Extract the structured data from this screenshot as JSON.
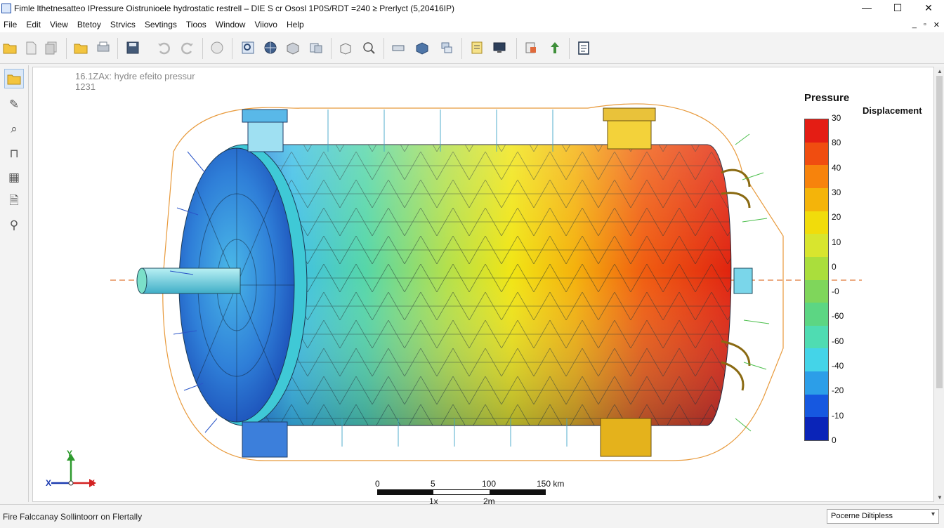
{
  "window": {
    "title": "Fimle lthetnesatteo IPressure Oistrunioele hydrostatic restrell – DIE S cr Ososl  1P0S/RDT =240 ≥ Prerlyct (5,20416IP)",
    "controls": [
      "—",
      "☐",
      "✕"
    ]
  },
  "menu": {
    "items": [
      "File",
      "Edit",
      "View",
      "Btetoy",
      "Strvics",
      "Sevtings",
      "Tioos",
      "Window",
      "Viiovo",
      "Help"
    ],
    "mdi_controls": [
      "_",
      "▫",
      "✕"
    ]
  },
  "toolbar": {
    "buttons": [
      "open-folder",
      "new-file",
      "copy-pages",
      "folder",
      "print-preview",
      "save-disk",
      "undo",
      "redo",
      "fit-view",
      "zoom-region",
      "globe",
      "cube-shaded",
      "window-layers",
      "box-3d",
      "zoom-settings",
      "measure",
      "package",
      "stack-layers",
      "checklist",
      "monitor",
      "export-doc",
      "upload-arrow",
      "report"
    ]
  },
  "left_tools": [
    "open-file",
    "pencil-edit",
    "zoom-search",
    "clamp-tool",
    "mesh-grid",
    "document-search",
    "node-select"
  ],
  "viewport": {
    "label_line1": "16.1ZAx:  hydre efeito pressur",
    "label_line2": "1231",
    "axes": {
      "x": "X",
      "y": "Y"
    }
  },
  "legend": {
    "title": "Pressure",
    "subtitle": "Displacement",
    "ticks": [
      "30",
      "80",
      "40",
      "30",
      "20",
      "10",
      "0",
      "-0",
      "-60",
      "-60",
      "-40",
      "-20",
      "-10",
      "0"
    ],
    "colors": [
      "#e41d14",
      "#f04d10",
      "#f7830c",
      "#f4b40a",
      "#f1dc0b",
      "#d8e52e",
      "#aade3c",
      "#7fd65b",
      "#5cd683",
      "#4fdcb2",
      "#44d4e8",
      "#2c9ee8",
      "#1658e0",
      "#0a24b8"
    ]
  },
  "scale_bar": {
    "top_labels": [
      "0",
      "5",
      "100",
      "150 km"
    ],
    "bottom_labels": [
      "1x",
      "2m"
    ]
  },
  "status": {
    "left": "Fire Falccanay Sollintoorr on Flertally",
    "select_value": "Pocerne Diltipless"
  }
}
